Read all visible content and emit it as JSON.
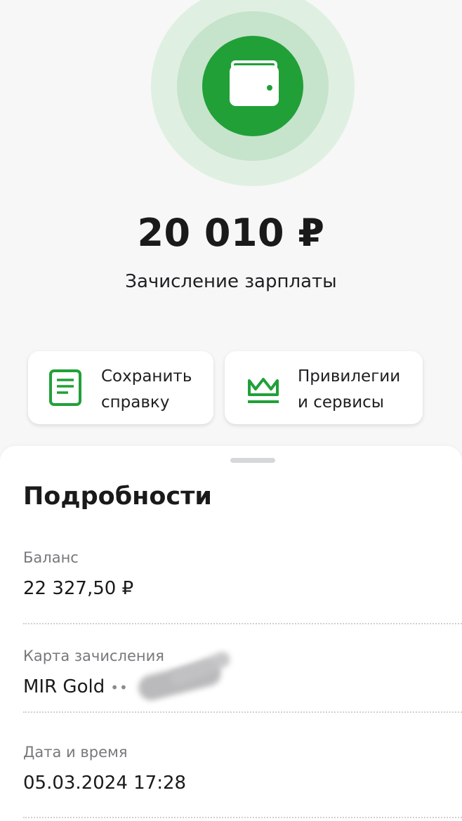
{
  "hero": {
    "icon": "wallet-icon",
    "amount": "20 010 ₽",
    "subtitle": "Зачисление зарплаты",
    "accent_color": "#21a038"
  },
  "actions": [
    {
      "label": "Сохранить\nсправку",
      "icon": "document-icon"
    },
    {
      "label": "Привилегии\nи сервисы",
      "icon": "crown-icon"
    }
  ],
  "details": {
    "title": "Подробности",
    "balance": {
      "label": "Баланс",
      "value": "22 327,50 ₽"
    },
    "card": {
      "label": "Карта зачисления",
      "value": "MIR Gold",
      "masked": "••"
    },
    "datetime": {
      "label": "Дата и время",
      "value": "05.03.2024 17:28"
    }
  }
}
